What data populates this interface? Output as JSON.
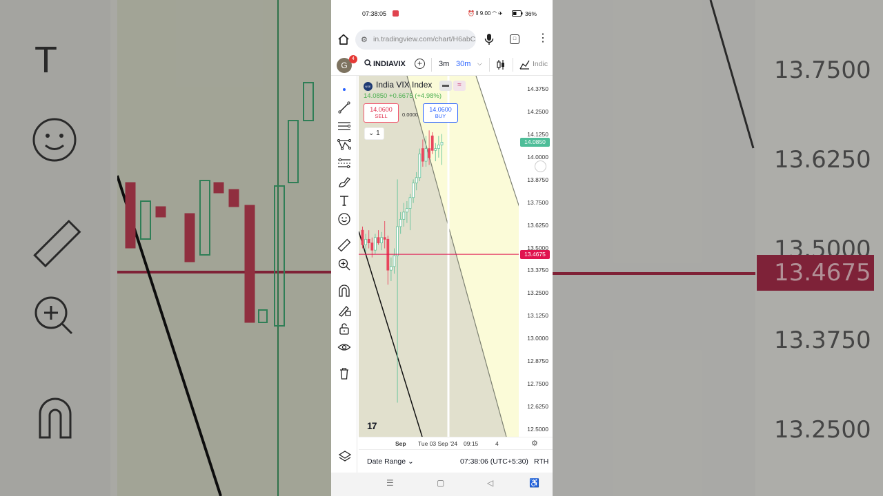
{
  "status_bar": {
    "time": "07:38:05",
    "icons": "⏰ ⫴ 9.00 ◠ ✈",
    "battery": "36%"
  },
  "browser": {
    "url": "in.tradingview.com/chart/H6abC"
  },
  "header": {
    "avatar_letter": "G",
    "notification_count": "4",
    "symbol": "INDIAVIX",
    "interval_primary": "3m",
    "interval_active": "30m",
    "indicators_label": "Indic"
  },
  "legend": {
    "title": "India VIX Index",
    "price_change": "14.0850  +0.6675 (+4.98%)",
    "sell_price": "14.0600",
    "sell_label": "SELL",
    "spread": "0.0000",
    "buy_price": "14.0600",
    "buy_label": "BUY",
    "collapse_count": "1"
  },
  "yaxis": {
    "ticks": [
      "14.3750",
      "14.2500",
      "14.1250",
      "14.0000",
      "13.8750",
      "13.7500",
      "13.6250",
      "13.5000",
      "13.3750",
      "13.2500",
      "13.1250",
      "13.0000",
      "12.8750",
      "12.7500",
      "12.6250",
      "12.5000"
    ],
    "last_price": "14.0850",
    "horizontal_line_price": "13.4675",
    "last_price_color": "#4dbd98",
    "line_color": "#e0134f"
  },
  "xaxis": {
    "label_month": "Sep",
    "label_date": "Tue 03 Sep '24",
    "label_time": "09:15",
    "label_4": "4"
  },
  "bottom": {
    "date_range": "Date Range",
    "clock": "07:38:06 (UTC+5:30)",
    "session": "RTH"
  },
  "background": {
    "prices": [
      "13.7500",
      "13.6250",
      "13.5000",
      "13.3750",
      "13.2500"
    ],
    "highlight_price": "13.4675"
  },
  "chart_data": {
    "type": "candlestick",
    "title": "India VIX Index",
    "ylim": [
      12.5,
      14.375
    ],
    "horizontal_line": 13.4675,
    "last_price": 14.085,
    "candles": [
      {
        "o": 13.6,
        "h": 13.62,
        "l": 13.5,
        "c": 13.52
      },
      {
        "o": 13.52,
        "h": 13.58,
        "l": 13.48,
        "c": 13.55
      },
      {
        "o": 13.55,
        "h": 13.6,
        "l": 13.5,
        "c": 13.53
      },
      {
        "o": 13.53,
        "h": 13.56,
        "l": 13.45,
        "c": 13.49
      },
      {
        "o": 13.49,
        "h": 13.58,
        "l": 13.47,
        "c": 13.56
      },
      {
        "o": 13.56,
        "h": 13.6,
        "l": 13.52,
        "c": 13.53
      },
      {
        "o": 13.53,
        "h": 13.59,
        "l": 13.49,
        "c": 13.56
      },
      {
        "o": 13.56,
        "h": 13.65,
        "l": 13.5,
        "c": 13.55
      },
      {
        "o": 13.55,
        "h": 13.57,
        "l": 13.3,
        "c": 13.38
      },
      {
        "o": 13.38,
        "h": 13.45,
        "l": 13.32,
        "c": 13.4
      },
      {
        "o": 13.4,
        "h": 13.5,
        "l": 13.36,
        "c": 13.46
      },
      {
        "o": 13.46,
        "h": 13.88,
        "l": 12.65,
        "c": 13.62
      },
      {
        "o": 13.62,
        "h": 13.7,
        "l": 13.58,
        "c": 13.66
      },
      {
        "o": 13.66,
        "h": 13.75,
        "l": 13.62,
        "c": 13.7
      },
      {
        "o": 13.7,
        "h": 13.76,
        "l": 13.64,
        "c": 13.72
      },
      {
        "o": 13.72,
        "h": 13.8,
        "l": 13.6,
        "c": 13.78
      },
      {
        "o": 13.78,
        "h": 13.88,
        "l": 13.75,
        "c": 13.86
      },
      {
        "o": 13.86,
        "h": 13.92,
        "l": 13.82,
        "c": 13.89
      },
      {
        "o": 13.89,
        "h": 14.05,
        "l": 13.87,
        "c": 14.02
      },
      {
        "o": 14.05,
        "h": 14.1,
        "l": 13.95,
        "c": 13.98
      },
      {
        "o": 13.98,
        "h": 14.12,
        "l": 13.95,
        "c": 14.05
      },
      {
        "o": 14.05,
        "h": 14.15,
        "l": 13.96,
        "c": 14.0
      },
      {
        "o": 14.12,
        "h": 14.14,
        "l": 14.02,
        "c": 14.04
      },
      {
        "o": 14.04,
        "h": 14.08,
        "l": 13.98,
        "c": 14.05
      },
      {
        "o": 14.05,
        "h": 14.12,
        "l": 14.0,
        "c": 14.07
      },
      {
        "o": 14.07,
        "h": 14.13,
        "l": 13.96,
        "c": 14.085
      }
    ]
  }
}
